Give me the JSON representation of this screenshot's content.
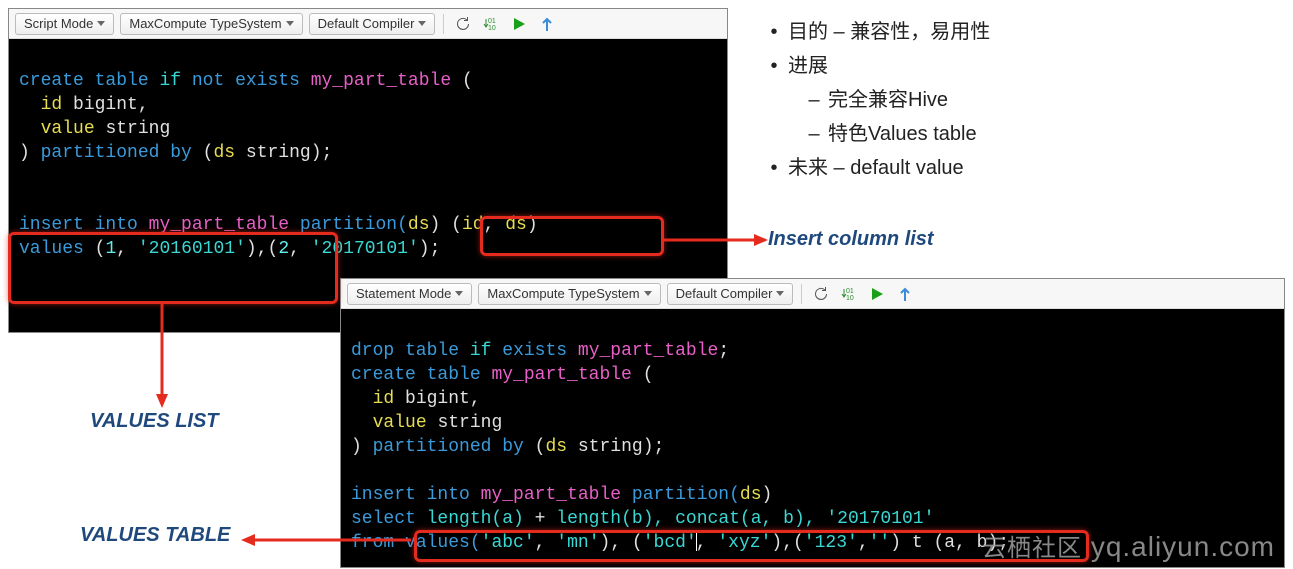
{
  "editor1": {
    "toolbar": {
      "mode": "Script Mode",
      "typesystem": "MaxCompute TypeSystem",
      "compiler": "Default Compiler"
    },
    "code": {
      "l1a": "create table",
      "l1b": "if",
      "l1c": "not exists",
      "l1d": "my_part_table",
      "l1e": "(",
      "l2a": "id",
      "l2b": "bigint,",
      "l3a": "value",
      "l3b": "string",
      "l4a": ")",
      "l4b": "partitioned by",
      "l4c": "(",
      "l4d": "ds",
      "l4e": "string);",
      "l6a": "insert into",
      "l6b": "my_part_table",
      "l6c": "partition(",
      "l6d": "ds",
      "l6e": ")",
      "l6f": "(",
      "l6g": "id",
      "l6h": ",",
      "l6i": "ds",
      "l6j": ")",
      "l7a": "values",
      "l7b": "(",
      "l7c": "1",
      "l7d": ",",
      "l7e": "'20160101'",
      "l7f": "),(",
      "l7g": "2",
      "l7h": ",",
      "l7i": "'20170101'",
      "l7j": ");"
    }
  },
  "editor2": {
    "toolbar": {
      "mode": "Statement Mode",
      "typesystem": "MaxCompute TypeSystem",
      "compiler": "Default Compiler"
    },
    "code": {
      "l1a": "drop table",
      "l1b": "if",
      "l1c": "exists",
      "l1d": "my_part_table",
      "l1e": ";",
      "l2a": "create table",
      "l2b": "my_part_table",
      "l2c": "(",
      "l3a": "id",
      "l3b": "bigint,",
      "l4a": "value",
      "l4b": "string",
      "l5a": ")",
      "l5b": "partitioned by",
      "l5c": "(",
      "l5d": "ds",
      "l5e": "string);",
      "l7a": "insert into",
      "l7b": "my_part_table",
      "l7c": "partition(",
      "l7d": "ds",
      "l7e": ")",
      "l8a": "select",
      "l8b": "length(a)",
      "l8c": "+",
      "l8d": "length(b),",
      "l8e": "concat(a, b),",
      "l8f": "'20170101'",
      "l9a": "from",
      "l9b": "values(",
      "l9c": "'abc'",
      "l9d": ",",
      "l9e": "'mn'",
      "l9f": "), (",
      "l9g": "'bcd'",
      "l9h": ",",
      "l9i": "'xyz'",
      "l9j": "),(",
      "l9k": "'123'",
      "l9l": ",",
      "l9m": "''",
      "l9n": ") t (a, b);"
    }
  },
  "notes": {
    "b1": "目的 – 兼容性，易用性",
    "b2": "进展",
    "b2a": "完全兼容Hive",
    "b2b": "特色Values table",
    "b3": "未来 – default value"
  },
  "labels": {
    "insert": "Insert column list",
    "vlist": "VALUES LIST",
    "vtable": "VALUES TABLE"
  },
  "watermark": {
    "cn": "云栖社区",
    "en": "yq.aliyun.com"
  }
}
